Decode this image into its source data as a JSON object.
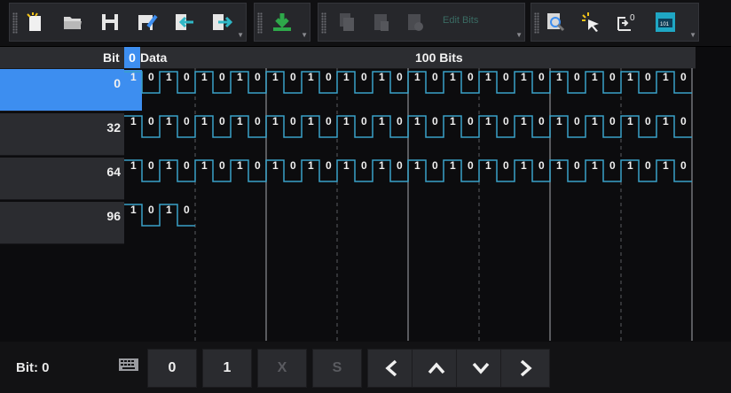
{
  "toolbar": {
    "groups": [
      {
        "name": "file",
        "icons": [
          "new-file-icon",
          "open-folder-icon",
          "save-icon",
          "save-as-icon",
          "import-icon",
          "export-icon"
        ]
      },
      {
        "name": "download",
        "icons": [
          "download-icon"
        ]
      },
      {
        "name": "clipboard",
        "icons": [
          "copy-icon",
          "paste-icon",
          "paste-special-icon"
        ],
        "disabled_label": "Edit Bits"
      },
      {
        "name": "view",
        "icons": [
          "zoom-icon",
          "select-cursor-icon",
          "set-bit-zero-icon",
          "binary-view-icon"
        ]
      }
    ]
  },
  "header": {
    "column_bit": "Bit",
    "column_data": "Data",
    "selected_bit": "0",
    "total_bits": "100 Bits"
  },
  "rows": [
    {
      "offset": "0",
      "bits": "10101010101010101010101010101010"
    },
    {
      "offset": "32",
      "bits": "10101010101010101010101010101010"
    },
    {
      "offset": "64",
      "bits": "10101010101010101010101010101010"
    },
    {
      "offset": "96",
      "bits": "1010"
    }
  ],
  "status": {
    "bit_label": "Bit:",
    "bit_value": "0"
  },
  "buttons": {
    "zero": "0",
    "one": "1",
    "x": "X",
    "s": "S"
  },
  "colors": {
    "accent": "#3d8ef0",
    "waveform": "#3aa2c8",
    "background": "#0c0c0e"
  }
}
